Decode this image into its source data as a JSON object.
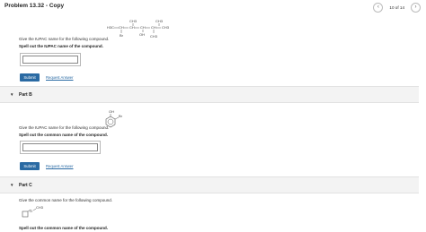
{
  "header": {
    "title": "Problem 13.32 - Copy",
    "counter": "10 of 14"
  },
  "part_a": {
    "question": "Give the IUPAC name for the following compound.",
    "instruction": "Spell out the IUPAC name of the compound.",
    "answer_value": "",
    "submit_label": "Submit",
    "request_label": "Request Answer",
    "structure": {
      "labels": [
        "CH3",
        "CH3",
        "H3C",
        "CH",
        "CH",
        "CH",
        "CH",
        "CH3",
        "Br",
        "OH",
        "CH3"
      ]
    }
  },
  "part_b": {
    "title": "Part B",
    "question": "Give the IUPAC name for the following compound.",
    "instruction": "Spell out the common name of the compound.",
    "answer_value": "",
    "submit_label": "Submit",
    "request_label": "Request Answer",
    "structure": {
      "labels": [
        "OH",
        "Br"
      ]
    }
  },
  "part_c": {
    "title": "Part C",
    "question": "Give the common name for the following compound.",
    "instruction": "Spell out the common name of the compound.",
    "structure": {
      "labels": [
        "O",
        "CH3"
      ]
    }
  }
}
